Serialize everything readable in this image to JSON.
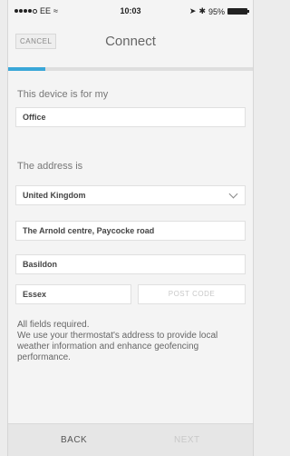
{
  "status_bar": {
    "carrier": "EE",
    "time": "10:03",
    "battery": "95%"
  },
  "header": {
    "cancel_label": "CANCEL",
    "title": "Connect"
  },
  "progress": {
    "fraction": 0.15,
    "color": "#3aa7d8"
  },
  "form": {
    "device_label": "This device is for my",
    "device_value": "Office",
    "address_label": "The address is",
    "country": "United Kingdom",
    "street": "The Arnold centre, Paycocke road",
    "city": "Basildon",
    "county": "Essex",
    "postcode_placeholder": "POST CODE"
  },
  "note": {
    "line1": "All fields required.",
    "line2": "We use your thermostat's address to provide local weather information and enhance geofencing performance."
  },
  "footer": {
    "back_label": "BACK",
    "next_label": "NEXT"
  }
}
